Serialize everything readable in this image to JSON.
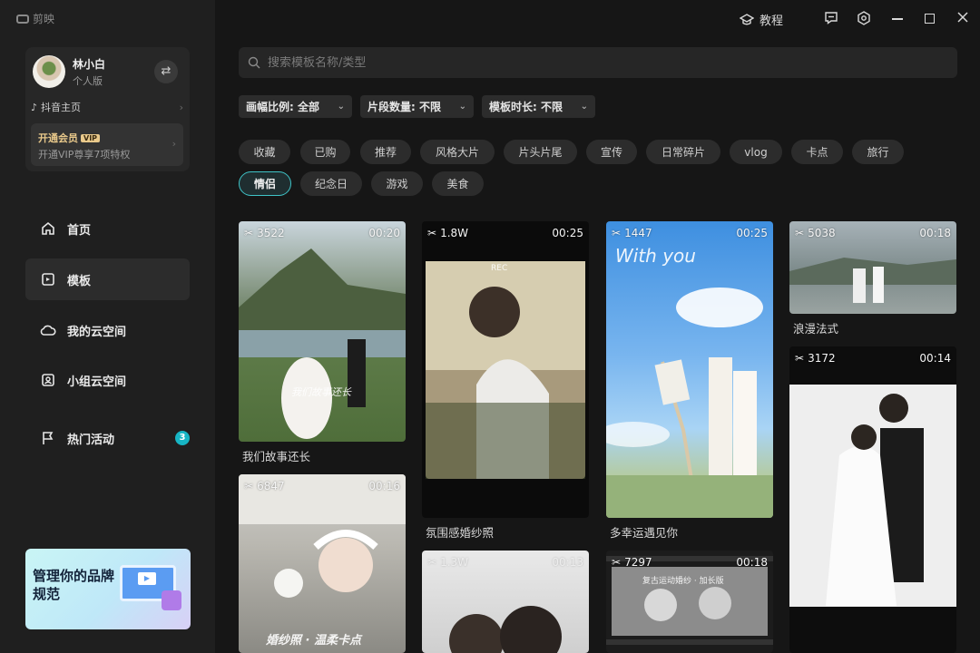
{
  "app": {
    "name": "剪映"
  },
  "titlebar": {
    "tutorial": "教程"
  },
  "profile": {
    "name": "林小白",
    "tier": "个人版",
    "douyin": "抖音主页",
    "vip_title": "开通会员",
    "vip_badge": "VIP",
    "vip_sub": "开通VIP尊享7项特权"
  },
  "nav": [
    {
      "label": "首页"
    },
    {
      "label": "模板"
    },
    {
      "label": "我的云空间"
    },
    {
      "label": "小组云空间"
    },
    {
      "label": "热门活动",
      "badge": "3"
    }
  ],
  "banner": {
    "title": "管理你的品牌规范"
  },
  "search": {
    "placeholder": "搜索模板名称/类型"
  },
  "filters": [
    {
      "label": "画幅比例: 全部"
    },
    {
      "label": "片段数量: 不限"
    },
    {
      "label": "模板时长: 不限"
    }
  ],
  "chips": [
    "收藏",
    "已购",
    "推荐",
    "风格大片",
    "片头片尾",
    "宣传",
    "日常碎片",
    "vlog",
    "卡点",
    "旅行",
    "情侣",
    "纪念日",
    "游戏",
    "美食"
  ],
  "active_chip": "情侣",
  "cards": [
    {
      "count": "3522",
      "duration": "00:20",
      "title": "我们故事还长",
      "overlay": "我们故事还长"
    },
    {
      "count": "6847",
      "duration": "00:16",
      "title": "",
      "overlay": "婚纱照 · 温柔卡点"
    },
    {
      "count": "1.8W",
      "duration": "00:25",
      "title": "氛围感婚纱照",
      "overlay": "REC"
    },
    {
      "count": "1.3W",
      "duration": "00:13",
      "title": "",
      "overlay": ""
    },
    {
      "count": "1447",
      "duration": "00:25",
      "title": "多幸运遇见你",
      "overlay": "With you"
    },
    {
      "count": "7297",
      "duration": "00:18",
      "title": "",
      "overlay": "复古运动婚纱 · 加长版"
    },
    {
      "count": "5038",
      "duration": "00:18",
      "title": "浪漫法式",
      "overlay": ""
    },
    {
      "count": "3172",
      "duration": "00:14",
      "title": "",
      "overlay": ""
    }
  ],
  "colors": {
    "accent": "#3fc4c8",
    "vip_gold": "#e9c98b",
    "badge": "#17b5c4"
  }
}
